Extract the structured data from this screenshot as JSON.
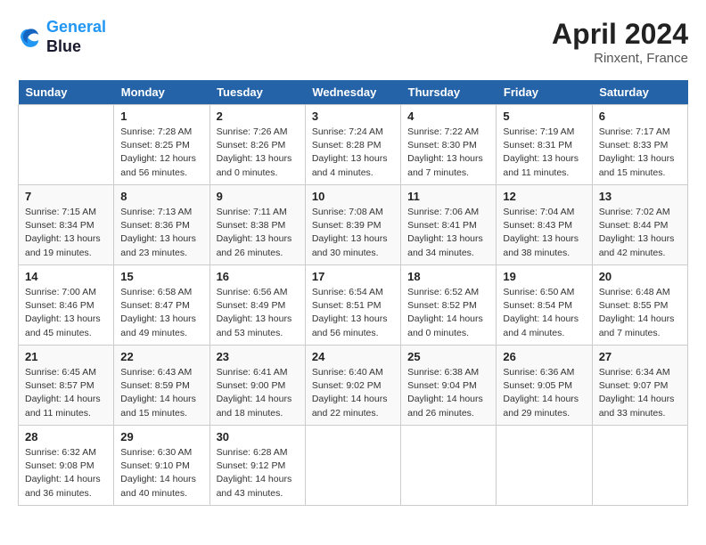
{
  "header": {
    "logo_line1": "General",
    "logo_line2": "Blue",
    "month": "April 2024",
    "location": "Rinxent, France"
  },
  "days_of_week": [
    "Sunday",
    "Monday",
    "Tuesday",
    "Wednesday",
    "Thursday",
    "Friday",
    "Saturday"
  ],
  "weeks": [
    [
      {
        "day": "",
        "sunrise": "",
        "sunset": "",
        "daylight": ""
      },
      {
        "day": "1",
        "sunrise": "Sunrise: 7:28 AM",
        "sunset": "Sunset: 8:25 PM",
        "daylight": "Daylight: 12 hours and 56 minutes."
      },
      {
        "day": "2",
        "sunrise": "Sunrise: 7:26 AM",
        "sunset": "Sunset: 8:26 PM",
        "daylight": "Daylight: 13 hours and 0 minutes."
      },
      {
        "day": "3",
        "sunrise": "Sunrise: 7:24 AM",
        "sunset": "Sunset: 8:28 PM",
        "daylight": "Daylight: 13 hours and 4 minutes."
      },
      {
        "day": "4",
        "sunrise": "Sunrise: 7:22 AM",
        "sunset": "Sunset: 8:30 PM",
        "daylight": "Daylight: 13 hours and 7 minutes."
      },
      {
        "day": "5",
        "sunrise": "Sunrise: 7:19 AM",
        "sunset": "Sunset: 8:31 PM",
        "daylight": "Daylight: 13 hours and 11 minutes."
      },
      {
        "day": "6",
        "sunrise": "Sunrise: 7:17 AM",
        "sunset": "Sunset: 8:33 PM",
        "daylight": "Daylight: 13 hours and 15 minutes."
      }
    ],
    [
      {
        "day": "7",
        "sunrise": "Sunrise: 7:15 AM",
        "sunset": "Sunset: 8:34 PM",
        "daylight": "Daylight: 13 hours and 19 minutes."
      },
      {
        "day": "8",
        "sunrise": "Sunrise: 7:13 AM",
        "sunset": "Sunset: 8:36 PM",
        "daylight": "Daylight: 13 hours and 23 minutes."
      },
      {
        "day": "9",
        "sunrise": "Sunrise: 7:11 AM",
        "sunset": "Sunset: 8:38 PM",
        "daylight": "Daylight: 13 hours and 26 minutes."
      },
      {
        "day": "10",
        "sunrise": "Sunrise: 7:08 AM",
        "sunset": "Sunset: 8:39 PM",
        "daylight": "Daylight: 13 hours and 30 minutes."
      },
      {
        "day": "11",
        "sunrise": "Sunrise: 7:06 AM",
        "sunset": "Sunset: 8:41 PM",
        "daylight": "Daylight: 13 hours and 34 minutes."
      },
      {
        "day": "12",
        "sunrise": "Sunrise: 7:04 AM",
        "sunset": "Sunset: 8:43 PM",
        "daylight": "Daylight: 13 hours and 38 minutes."
      },
      {
        "day": "13",
        "sunrise": "Sunrise: 7:02 AM",
        "sunset": "Sunset: 8:44 PM",
        "daylight": "Daylight: 13 hours and 42 minutes."
      }
    ],
    [
      {
        "day": "14",
        "sunrise": "Sunrise: 7:00 AM",
        "sunset": "Sunset: 8:46 PM",
        "daylight": "Daylight: 13 hours and 45 minutes."
      },
      {
        "day": "15",
        "sunrise": "Sunrise: 6:58 AM",
        "sunset": "Sunset: 8:47 PM",
        "daylight": "Daylight: 13 hours and 49 minutes."
      },
      {
        "day": "16",
        "sunrise": "Sunrise: 6:56 AM",
        "sunset": "Sunset: 8:49 PM",
        "daylight": "Daylight: 13 hours and 53 minutes."
      },
      {
        "day": "17",
        "sunrise": "Sunrise: 6:54 AM",
        "sunset": "Sunset: 8:51 PM",
        "daylight": "Daylight: 13 hours and 56 minutes."
      },
      {
        "day": "18",
        "sunrise": "Sunrise: 6:52 AM",
        "sunset": "Sunset: 8:52 PM",
        "daylight": "Daylight: 14 hours and 0 minutes."
      },
      {
        "day": "19",
        "sunrise": "Sunrise: 6:50 AM",
        "sunset": "Sunset: 8:54 PM",
        "daylight": "Daylight: 14 hours and 4 minutes."
      },
      {
        "day": "20",
        "sunrise": "Sunrise: 6:48 AM",
        "sunset": "Sunset: 8:55 PM",
        "daylight": "Daylight: 14 hours and 7 minutes."
      }
    ],
    [
      {
        "day": "21",
        "sunrise": "Sunrise: 6:45 AM",
        "sunset": "Sunset: 8:57 PM",
        "daylight": "Daylight: 14 hours and 11 minutes."
      },
      {
        "day": "22",
        "sunrise": "Sunrise: 6:43 AM",
        "sunset": "Sunset: 8:59 PM",
        "daylight": "Daylight: 14 hours and 15 minutes."
      },
      {
        "day": "23",
        "sunrise": "Sunrise: 6:41 AM",
        "sunset": "Sunset: 9:00 PM",
        "daylight": "Daylight: 14 hours and 18 minutes."
      },
      {
        "day": "24",
        "sunrise": "Sunrise: 6:40 AM",
        "sunset": "Sunset: 9:02 PM",
        "daylight": "Daylight: 14 hours and 22 minutes."
      },
      {
        "day": "25",
        "sunrise": "Sunrise: 6:38 AM",
        "sunset": "Sunset: 9:04 PM",
        "daylight": "Daylight: 14 hours and 26 minutes."
      },
      {
        "day": "26",
        "sunrise": "Sunrise: 6:36 AM",
        "sunset": "Sunset: 9:05 PM",
        "daylight": "Daylight: 14 hours and 29 minutes."
      },
      {
        "day": "27",
        "sunrise": "Sunrise: 6:34 AM",
        "sunset": "Sunset: 9:07 PM",
        "daylight": "Daylight: 14 hours and 33 minutes."
      }
    ],
    [
      {
        "day": "28",
        "sunrise": "Sunrise: 6:32 AM",
        "sunset": "Sunset: 9:08 PM",
        "daylight": "Daylight: 14 hours and 36 minutes."
      },
      {
        "day": "29",
        "sunrise": "Sunrise: 6:30 AM",
        "sunset": "Sunset: 9:10 PM",
        "daylight": "Daylight: 14 hours and 40 minutes."
      },
      {
        "day": "30",
        "sunrise": "Sunrise: 6:28 AM",
        "sunset": "Sunset: 9:12 PM",
        "daylight": "Daylight: 14 hours and 43 minutes."
      },
      {
        "day": "",
        "sunrise": "",
        "sunset": "",
        "daylight": ""
      },
      {
        "day": "",
        "sunrise": "",
        "sunset": "",
        "daylight": ""
      },
      {
        "day": "",
        "sunrise": "",
        "sunset": "",
        "daylight": ""
      },
      {
        "day": "",
        "sunrise": "",
        "sunset": "",
        "daylight": ""
      }
    ]
  ]
}
